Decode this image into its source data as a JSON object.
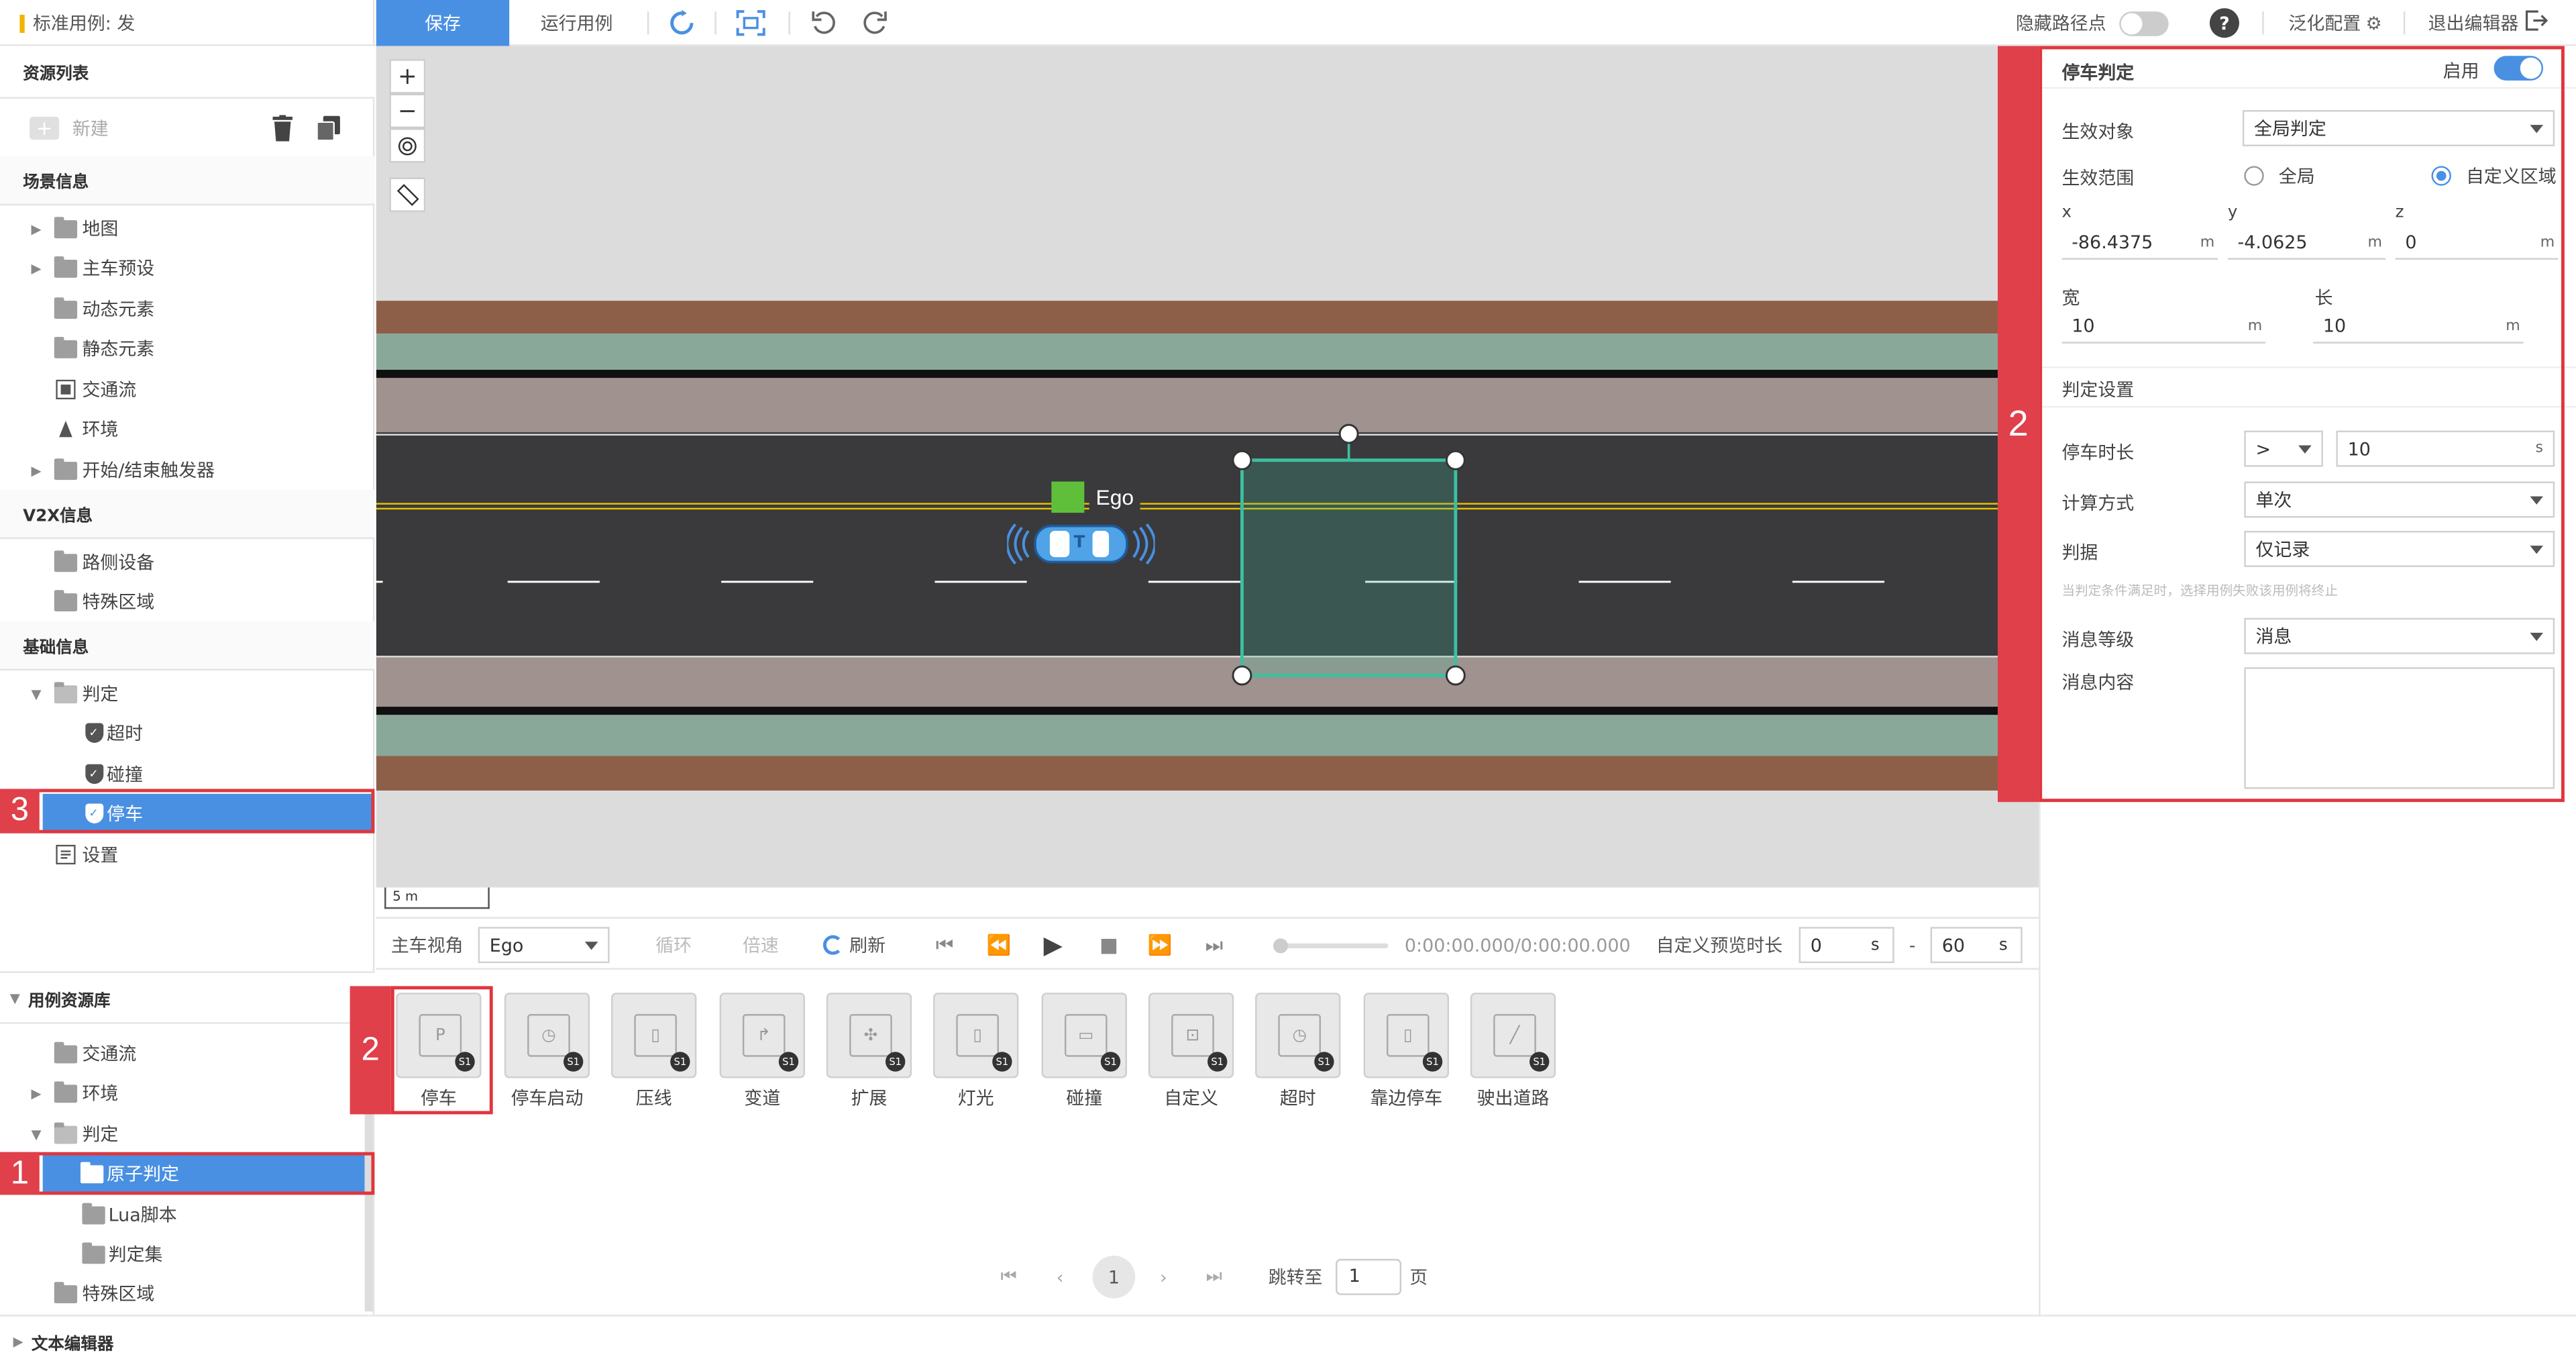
{
  "topbar": {
    "case_title": "标准用例: 发",
    "save": "保存",
    "run_case": "运行用例",
    "hide_waypoints": "隐藏路径点",
    "help": "?",
    "generalize": "泛化配置",
    "exit_editor": "退出编辑器"
  },
  "left": {
    "resource_list": "资源列表",
    "new": "新建",
    "scene_info": "场景信息",
    "scene_items": [
      "地图",
      "主车预设",
      "动态元素",
      "静态元素",
      "交通流",
      "环境",
      "开始/结束触发器"
    ],
    "v2x_info": "V2X信息",
    "v2x_items": [
      "路侧设备",
      "特殊区域"
    ],
    "basic_info": "基础信息",
    "judge": "判定",
    "judge_children": [
      "超时",
      "碰撞",
      "停车"
    ],
    "settings": "设置",
    "case_library": "用例资源库",
    "lib_items": [
      "交通流",
      "环境",
      "判定"
    ],
    "lib_judge_children": [
      "原子判定",
      "Lua脚本",
      "判定集"
    ],
    "lib_special": "特殊区域",
    "text_editor": "文本编辑器"
  },
  "annotations": {
    "n1": "1",
    "n2": "2",
    "n3": "3"
  },
  "map": {
    "ego_label": "Ego",
    "vehicle_letter": "T",
    "zoom_in": "+",
    "zoom_out": "−",
    "scale": "5 m",
    "colors": {
      "dirt": "#8e5f48",
      "grass": "#8aa89a",
      "curb": "#a0928f",
      "road": "#3a3a3c",
      "zone": "#3dbfa0"
    }
  },
  "controls": {
    "view_label": "主车视角",
    "view_value": "Ego",
    "loop": "循环",
    "speed": "倍速",
    "refresh": "刷新",
    "time": "0:00:00.000/0:00:00.000",
    "preview_label": "自定义预览时长",
    "preview_start": "0",
    "preview_end": "60",
    "unit_s": "s",
    "dash": "-"
  },
  "tiles": {
    "badge": "S1",
    "items": [
      "停车",
      "停车启动",
      "压线",
      "变道",
      "扩展",
      "灯光",
      "碰撞",
      "自定义",
      "超时",
      "靠边停车",
      "驶出道路"
    ]
  },
  "pagination": {
    "current": "1",
    "jump_label": "跳转至",
    "jump_value": "1",
    "page_suffix": "页"
  },
  "right": {
    "title": "停车判定",
    "enable": "启用",
    "target_label": "生效对象",
    "target_value": "全局判定",
    "scope_label": "生效范围",
    "scope_global": "全局",
    "scope_custom": "自定义区域",
    "x_label": "x",
    "x_value": "-86.4375",
    "y_label": "y",
    "y_value": "-4.0625",
    "z_label": "z",
    "z_value": "0",
    "unit_m": "m",
    "width_label": "宽",
    "width_value": "10",
    "length_label": "长",
    "length_value": "10",
    "judge_settings": "判定设置",
    "duration_label": "停车时长",
    "duration_op": ">",
    "duration_value": "10",
    "unit_s": "s",
    "calc_label": "计算方式",
    "calc_value": "单次",
    "verdict_label": "判据",
    "verdict_value": "仅记录",
    "hint": "当判定条件满足时，选择用例失败该用例将终止",
    "msg_level_label": "消息等级",
    "msg_level_value": "消息",
    "msg_content_label": "消息内容"
  }
}
